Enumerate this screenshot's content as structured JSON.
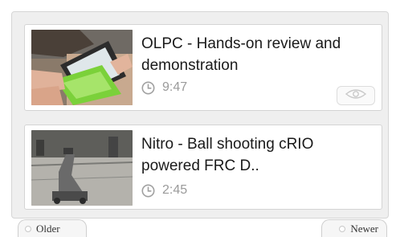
{
  "videos": [
    {
      "title": "OLPC - Hands-on review and demonstration",
      "duration": "9:47"
    },
    {
      "title": "Nitro - Ball shooting cRIO powered FRC D..",
      "duration": "2:45"
    }
  ],
  "pager": {
    "older_label": "Older",
    "newer_label": "Newer"
  },
  "icons": {
    "duration": "clock-icon",
    "watch": "eye-icon"
  },
  "colors": {
    "accent_green": "#7bd13a",
    "muted_text": "#9a9a9a"
  }
}
